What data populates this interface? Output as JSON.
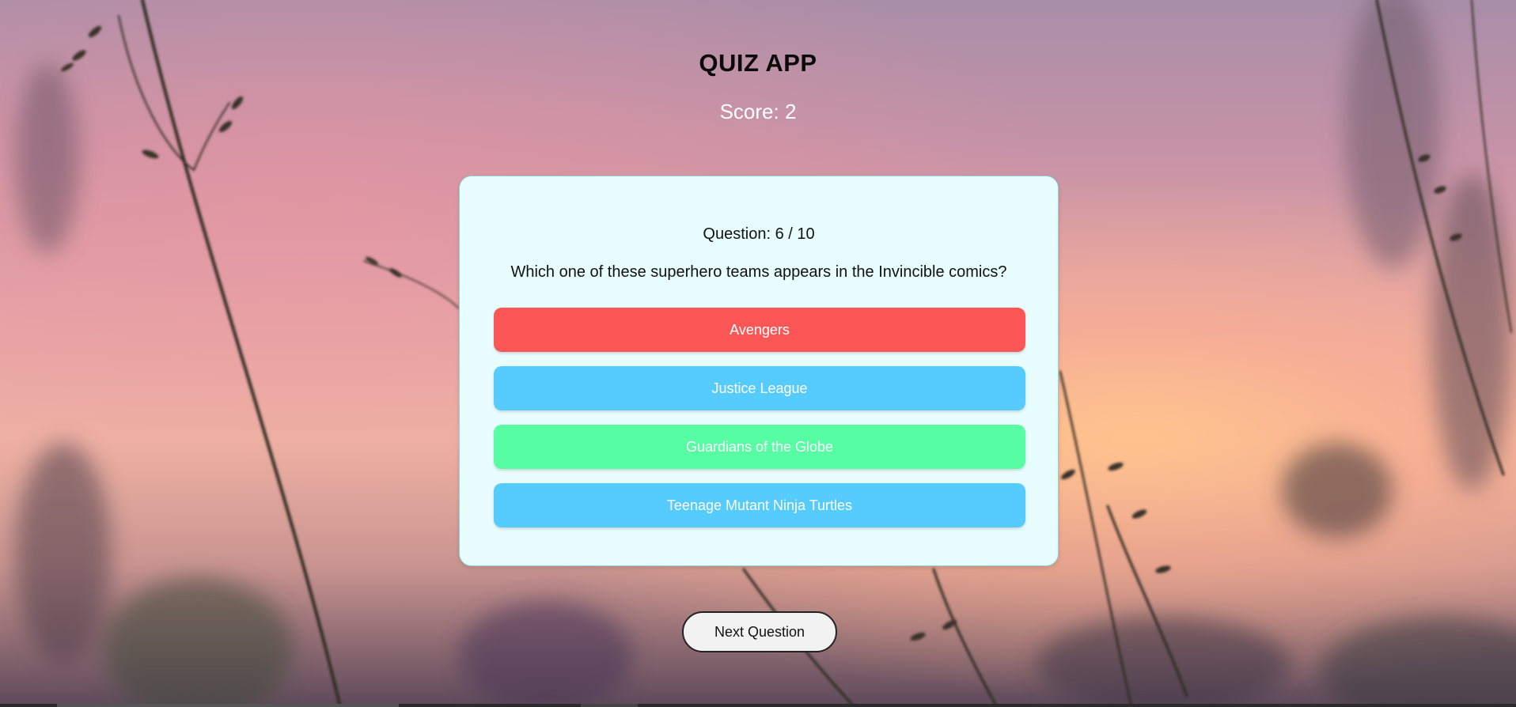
{
  "app": {
    "title": "QUIZ APP",
    "score_label": "Score: ",
    "score_value": "2"
  },
  "question": {
    "counter_label": "Question: ",
    "current": "6",
    "separator": " / ",
    "total": "10",
    "text": "Which one of these superhero teams appears in the Invincible comics?"
  },
  "answers": [
    {
      "label": "Avengers",
      "state": "incorrect",
      "color": "#fd5656"
    },
    {
      "label": "Justice League",
      "state": "neutral",
      "color": "#56cbfd"
    },
    {
      "label": "Guardians of the Globe",
      "state": "correct",
      "color": "#56fda3"
    },
    {
      "label": "Teenage Mutant Ninja Turtles",
      "state": "neutral",
      "color": "#56cbfd"
    }
  ],
  "controls": {
    "next_label": "Next Question"
  },
  "colors": {
    "card_background": "#e8fdfd",
    "incorrect": "#fd5656",
    "correct": "#56fda3",
    "neutral": "#56cbfd"
  }
}
